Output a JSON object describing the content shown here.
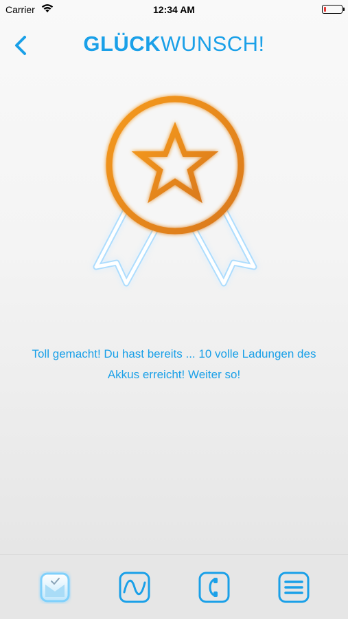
{
  "status_bar": {
    "carrier": "Carrier",
    "time": "12:34 AM"
  },
  "header": {
    "title_bold": "GLÜCK",
    "title_rest": "WUNSCH!",
    "back_icon": "chevron-left-icon"
  },
  "achievement": {
    "badge_icon": "award-ribbon-star-icon",
    "message": "Toll gemacht! Du hast bereits ... 10 volle Ladungen des Akkus erreicht! Weiter so!"
  },
  "tabbar": {
    "items": [
      {
        "icon": "awards-icon",
        "active": true
      },
      {
        "icon": "chart-wave-icon",
        "active": false
      },
      {
        "icon": "phone-contact-icon",
        "active": false
      },
      {
        "icon": "menu-icon",
        "active": false
      }
    ]
  },
  "colors": {
    "accent": "#1aa0e8",
    "medal": "#f0921c",
    "battery_low": "#e53935"
  }
}
